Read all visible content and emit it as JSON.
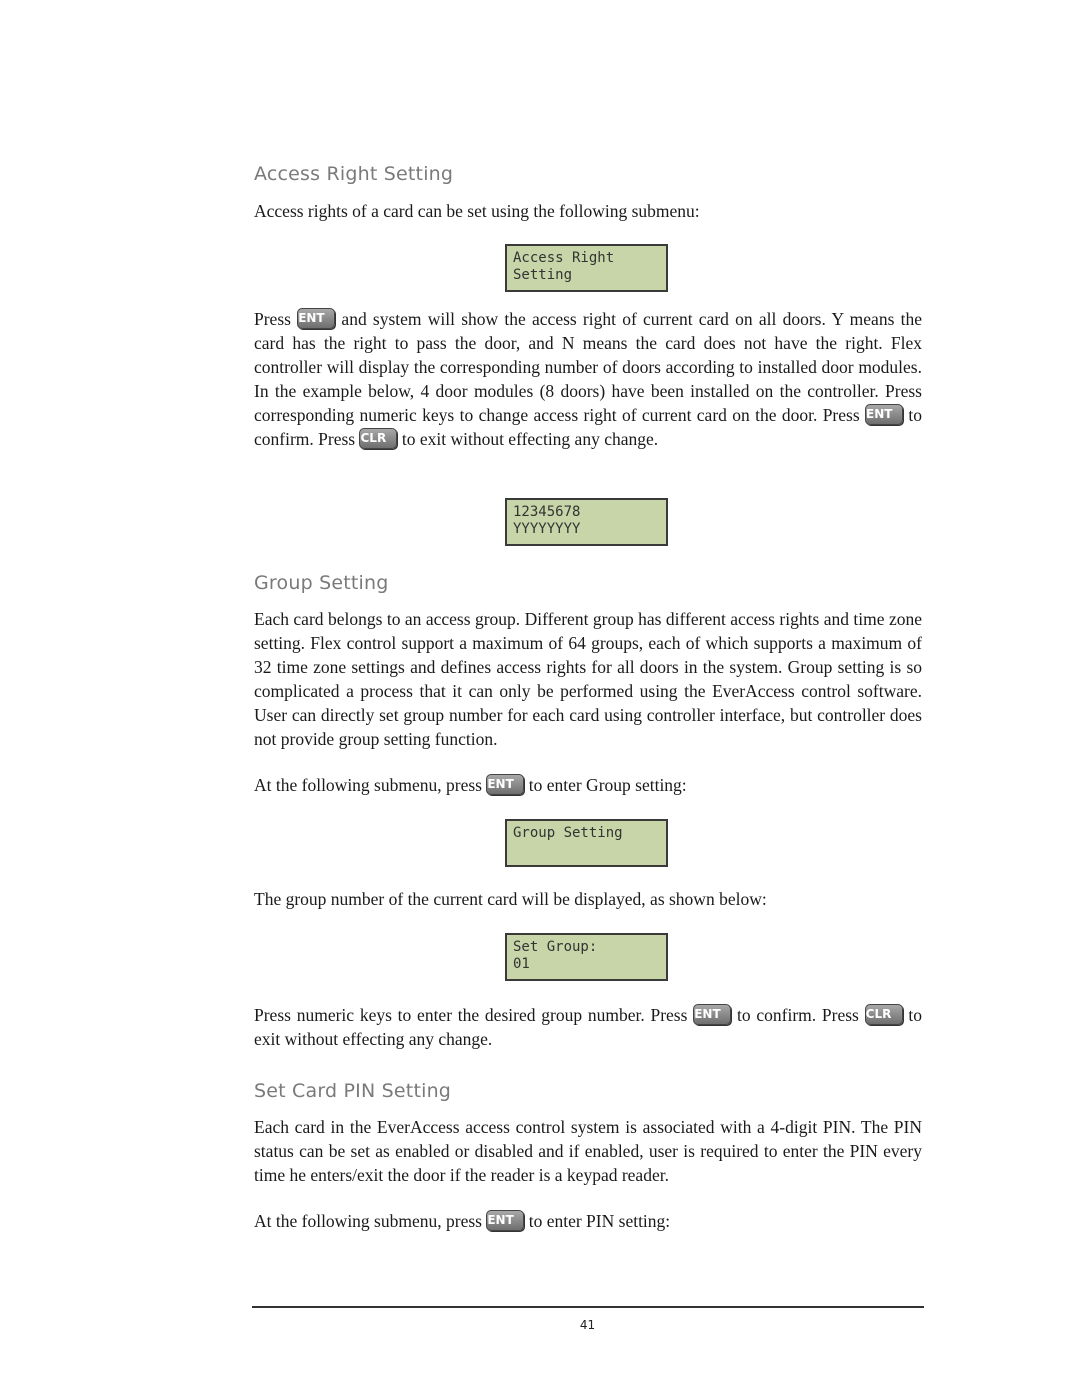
{
  "sections": [
    {
      "heading": "Access Right Setting"
    },
    {
      "heading": "Group Setting"
    },
    {
      "heading": "Set Card PIN Setting"
    }
  ],
  "keys": {
    "ent": "ENT",
    "clr": "CLR"
  },
  "paragraphs": {
    "p1": "Access rights of a card can be set using the following submenu:",
    "p2a": "Press",
    "p2b": "and system will show the access right of current card on all doors. Y means the card has the right to pass the door, and N means the card does not have the right. Flex controller will display the corresponding number of doors according to installed door modules. In the example below, 4 door modules (8 doors) have been installed on the controller. Press corresponding numeric keys to change access right of current card on the door. Press",
    "p2c": "to confirm. Press",
    "p2d": "to exit without effecting any change.",
    "p3": "Each card belongs to an access group. Different group has different access rights and time zone setting. Flex control support a maximum of 64 groups, each of which supports a maximum of 32 time zone settings and defines access rights for all doors in the system. Group setting is so complicated a process that it can only be performed using the EverAccess control software. User can directly set group number for each card using controller interface, but controller does not provide group setting function.",
    "p4a": "At the following submenu, press",
    "p4b": "to enter Group setting:",
    "p5": "The group number of the current card will be displayed, as shown below:",
    "p6a": "Press numeric keys to enter the desired group number. Press",
    "p6b": "to confirm. Press",
    "p6c": "to exit without effecting any change.",
    "p7": "Each card in the EverAccess access control system is associated with a 4-digit PIN. The PIN status can be set as enabled or disabled and if enabled, user is required to enter the PIN every time he enters/exit the door if the reader is a keypad reader.",
    "p8a": "At the following submenu, press",
    "p8b": "to enter PIN setting:"
  },
  "lcd": {
    "access_right": "Access Right\nSetting",
    "doors": "12345678\nYYYYYYYY",
    "group_setting": "Group Setting",
    "set_group": "Set Group:\n01"
  },
  "page_number": "41"
}
